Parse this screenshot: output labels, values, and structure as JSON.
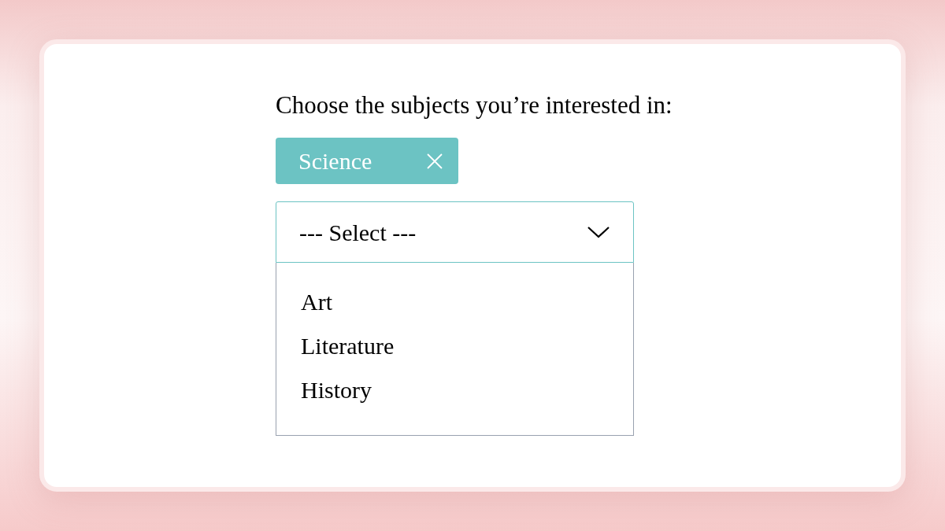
{
  "prompt": "Choose the subjects you’re interested in:",
  "chips": [
    {
      "label": "Science",
      "removable": true
    }
  ],
  "select": {
    "value": "--- Select ---",
    "expanded": true
  },
  "options": [
    {
      "label": "Art",
      "selected": false
    },
    {
      "label": "Literature",
      "selected": false
    },
    {
      "label": "History",
      "selected": false
    }
  ]
}
